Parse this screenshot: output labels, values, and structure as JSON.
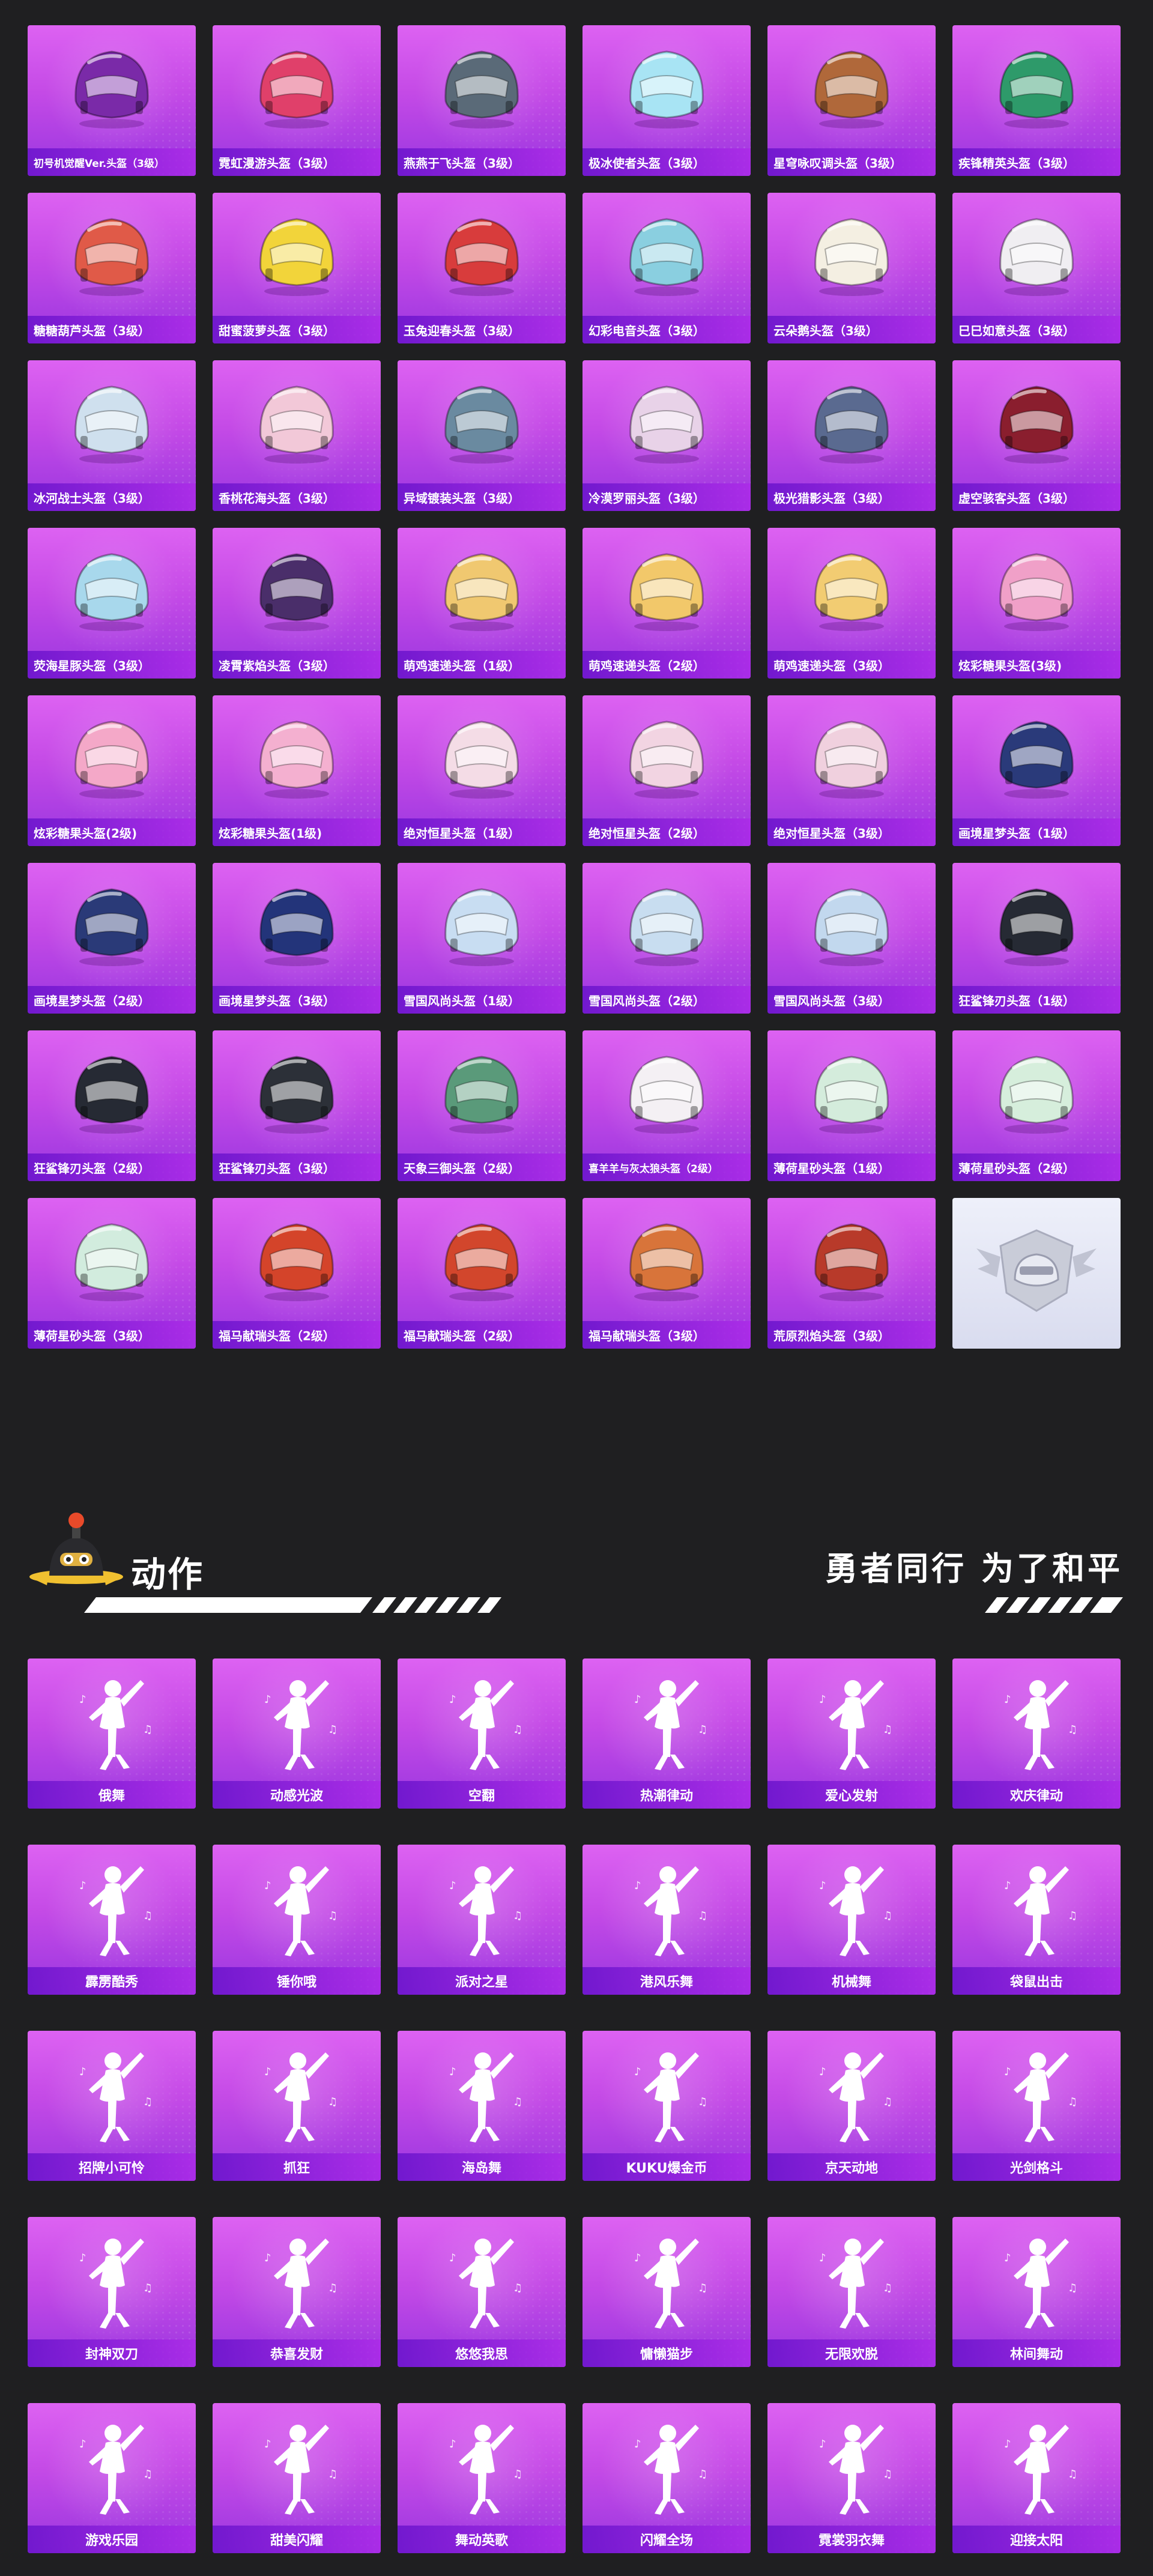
{
  "helmets": [
    {
      "label": "初号机觉醒Ver.头盔（3级）",
      "color": "#7a2aa8",
      "small": true
    },
    {
      "label": "霓虹漫游头盔（3级）",
      "color": "#e0406a"
    },
    {
      "label": "燕燕于飞头盔（3级）",
      "color": "#5a6a78"
    },
    {
      "label": "极冰使者头盔（3级）",
      "color": "#a8e4f4"
    },
    {
      "label": "星穹咏叹调头盔（3级）",
      "color": "#b0683a"
    },
    {
      "label": "疾锋精英头盔（3级）",
      "color": "#2e9a6a"
    },
    {
      "label": "糖糖葫芦头盔（3级）",
      "color": "#e05a48"
    },
    {
      "label": "甜蜜菠萝头盔（3级）",
      "color": "#f2d43a"
    },
    {
      "label": "玉兔迎春头盔（3级）",
      "color": "#d83c3c"
    },
    {
      "label": "幻彩电音头盔（3级）",
      "color": "#8acfe0"
    },
    {
      "label": "云朵鹅头盔（3级）",
      "color": "#f4efe2"
    },
    {
      "label": "巳巳如意头盔（3级）",
      "color": "#f0eef2"
    },
    {
      "label": "冰河战士头盔（3级）",
      "color": "#cfe0ee"
    },
    {
      "label": "香桃花海头盔（3级）",
      "color": "#f2c8d8"
    },
    {
      "label": "异域镀装头盔（3级）",
      "color": "#6a8aa0"
    },
    {
      "label": "冷漠罗丽头盔（3级）",
      "color": "#e8d2e8"
    },
    {
      "label": "极光猎影头盔（3级）",
      "color": "#5a6a90"
    },
    {
      "label": "虚空骇客头盔（3级）",
      "color": "#8a1e2e"
    },
    {
      "label": "荧海星豚头盔（3级）",
      "color": "#a8d8ec"
    },
    {
      "label": "凌霄紫焰头盔（3级）",
      "color": "#4a2e6a"
    },
    {
      "label": "萌鸡速递头盔（1级）",
      "color": "#f0c870"
    },
    {
      "label": "萌鸡速递头盔（2级）",
      "color": "#f2c86a"
    },
    {
      "label": "萌鸡速递头盔（3级）",
      "color": "#f2cc72"
    },
    {
      "label": "炫彩糖果头盔(3级)",
      "color": "#f0a0c8"
    },
    {
      "label": "炫彩糖果头盔(2级)",
      "color": "#f4a8c8"
    },
    {
      "label": "炫彩糖果头盔(1级)",
      "color": "#f4b0d0"
    },
    {
      "label": "绝对恒星头盔（1级）",
      "color": "#f4dce6"
    },
    {
      "label": "绝对恒星头盔（2级）",
      "color": "#f2d4e2"
    },
    {
      "label": "绝对恒星头盔（3级）",
      "color": "#f0d0de"
    },
    {
      "label": "画境星梦头盔（1级）",
      "color": "#2a3a7a"
    },
    {
      "label": "画境星梦头盔（2级）",
      "color": "#2a3a78"
    },
    {
      "label": "画境星梦头盔（3级）",
      "color": "#23347a"
    },
    {
      "label": "雪国风尚头盔（1级）",
      "color": "#c8ddf2"
    },
    {
      "label": "雪国风尚头盔（2级）",
      "color": "#c8ddf0"
    },
    {
      "label": "雪国风尚头盔（3级）",
      "color": "#c2d8ee"
    },
    {
      "label": "狂鲨锋刃头盔（1级）",
      "color": "#262a34"
    },
    {
      "label": "狂鲨锋刃头盔（2级）",
      "color": "#262a34"
    },
    {
      "label": "狂鲨锋刃头盔（3级）",
      "color": "#2c3038"
    },
    {
      "label": "天象三御头盔（2级）",
      "color": "#5a9a7a"
    },
    {
      "label": "喜羊羊与灰太狼头盔（2级）",
      "color": "#f4f0f4",
      "small": true
    },
    {
      "label": "薄荷星砂头盔（1级）",
      "color": "#d4ecdc"
    },
    {
      "label": "薄荷星砂头盔（2级）",
      "color": "#d6eedc"
    },
    {
      "label": "薄荷星砂头盔（3级）",
      "color": "#d2ecde"
    },
    {
      "label": "福马献瑞头盔（2级）",
      "color": "#d4442a"
    },
    {
      "label": "福马献瑞头盔（2级）",
      "color": "#d2462c"
    },
    {
      "label": "福马献瑞头盔（3级）",
      "color": "#d8743a"
    },
    {
      "label": "荒原烈焰头盔（3级）",
      "color": "#b83a2a"
    }
  ],
  "placeholder_icon": "pubg-winged-helmet-emblem",
  "section": {
    "title": "动作",
    "slogan": "勇者同行 为了和平"
  },
  "emotes": [
    {
      "label": "俄舞"
    },
    {
      "label": "动感光波"
    },
    {
      "label": "空翻"
    },
    {
      "label": "热潮律动"
    },
    {
      "label": "爱心发射"
    },
    {
      "label": "欢庆律动"
    },
    {
      "label": "霹雳酷秀"
    },
    {
      "label": "锤你哦"
    },
    {
      "label": "派对之星"
    },
    {
      "label": "港风乐舞"
    },
    {
      "label": "机械舞"
    },
    {
      "label": "袋鼠出击"
    },
    {
      "label": "招牌小可怜"
    },
    {
      "label": "抓狂"
    },
    {
      "label": "海岛舞"
    },
    {
      "label": "KUKU爆金币"
    },
    {
      "label": "京天动地"
    },
    {
      "label": "光剑格斗"
    },
    {
      "label": "封神双刀"
    },
    {
      "label": "恭喜发财"
    },
    {
      "label": "悠悠我思"
    },
    {
      "label": "慵懒猫步"
    },
    {
      "label": "无限欢脱"
    },
    {
      "label": "林间舞动"
    },
    {
      "label": "游戏乐园"
    },
    {
      "label": "甜美闪耀"
    },
    {
      "label": "舞动英歌"
    },
    {
      "label": "闪耀全场"
    },
    {
      "label": "霓裳羽衣舞"
    },
    {
      "label": "迎接太阳"
    }
  ],
  "emote_icon": "dancer-silhouette-icon",
  "colors": {
    "background": "#1f1f21",
    "card_top": "#dd62f2",
    "card_bottom": "#9a36e0",
    "label_bar": "#6e16cd"
  }
}
